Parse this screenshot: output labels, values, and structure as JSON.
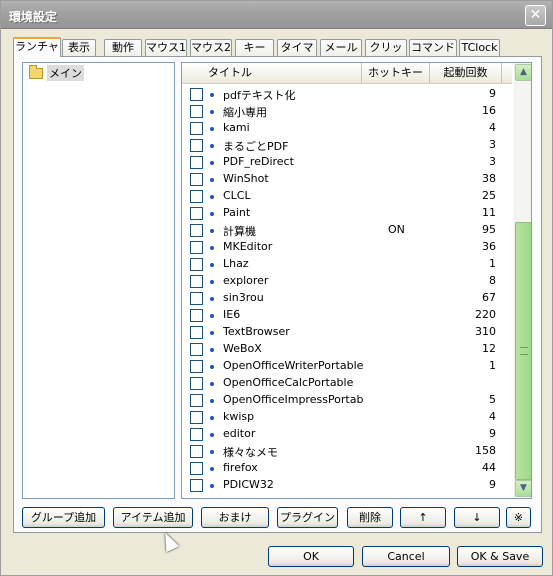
{
  "window": {
    "title": "環境設定"
  },
  "tabs": [
    "ランチャ",
    "表示",
    "動作",
    "マウス1",
    "マウス2",
    "キー",
    "タイマ",
    "メール",
    "クリップ",
    "コマンド",
    "TClock"
  ],
  "tree": {
    "items": [
      "メイン"
    ]
  },
  "list": {
    "columns": [
      "タイトル",
      "ホットキー",
      "起動回数"
    ],
    "rows": [
      {
        "title": "pdfテキスト化",
        "hotkey": "",
        "count": "9"
      },
      {
        "title": "縮小専用",
        "hotkey": "",
        "count": "16"
      },
      {
        "title": "kami",
        "hotkey": "",
        "count": "4"
      },
      {
        "title": "まるごとPDF",
        "hotkey": "",
        "count": "3"
      },
      {
        "title": "PDF_reDirect",
        "hotkey": "",
        "count": "3"
      },
      {
        "title": "WinShot",
        "hotkey": "",
        "count": "38"
      },
      {
        "title": "CLCL",
        "hotkey": "",
        "count": "25"
      },
      {
        "title": "Paint",
        "hotkey": "",
        "count": "11"
      },
      {
        "title": "計算機",
        "hotkey": "ON",
        "count": "95"
      },
      {
        "title": "MKEditor",
        "hotkey": "",
        "count": "36"
      },
      {
        "title": "Lhaz",
        "hotkey": "",
        "count": "1"
      },
      {
        "title": "explorer",
        "hotkey": "",
        "count": "8"
      },
      {
        "title": "sin3rou",
        "hotkey": "",
        "count": "67"
      },
      {
        "title": "IE6",
        "hotkey": "",
        "count": "220"
      },
      {
        "title": "TextBrowser",
        "hotkey": "",
        "count": "310"
      },
      {
        "title": "WeBoX",
        "hotkey": "",
        "count": "12"
      },
      {
        "title": "OpenOfficeWriterPortable",
        "hotkey": "",
        "count": "1"
      },
      {
        "title": "OpenOfficeCalcPortable",
        "hotkey": "",
        "count": ""
      },
      {
        "title": "OpenOfficeImpressPortab...",
        "hotkey": "",
        "count": "5"
      },
      {
        "title": "kwisp",
        "hotkey": "",
        "count": "4"
      },
      {
        "title": "editor",
        "hotkey": "",
        "count": "9"
      },
      {
        "title": "様々なメモ",
        "hotkey": "",
        "count": "158"
      },
      {
        "title": "firefox",
        "hotkey": "",
        "count": "44"
      },
      {
        "title": "PDICW32",
        "hotkey": "",
        "count": "9"
      }
    ]
  },
  "actions": [
    "グループ追加",
    "アイテム追加",
    "おまけ",
    "プラグイン",
    "削除",
    "↑",
    "↓",
    "※"
  ],
  "dialog": {
    "ok": "OK",
    "cancel": "Cancel",
    "ok_save": "OK & Save"
  },
  "icons": {
    "scroll_up": "▲",
    "scroll_down": "▼"
  }
}
